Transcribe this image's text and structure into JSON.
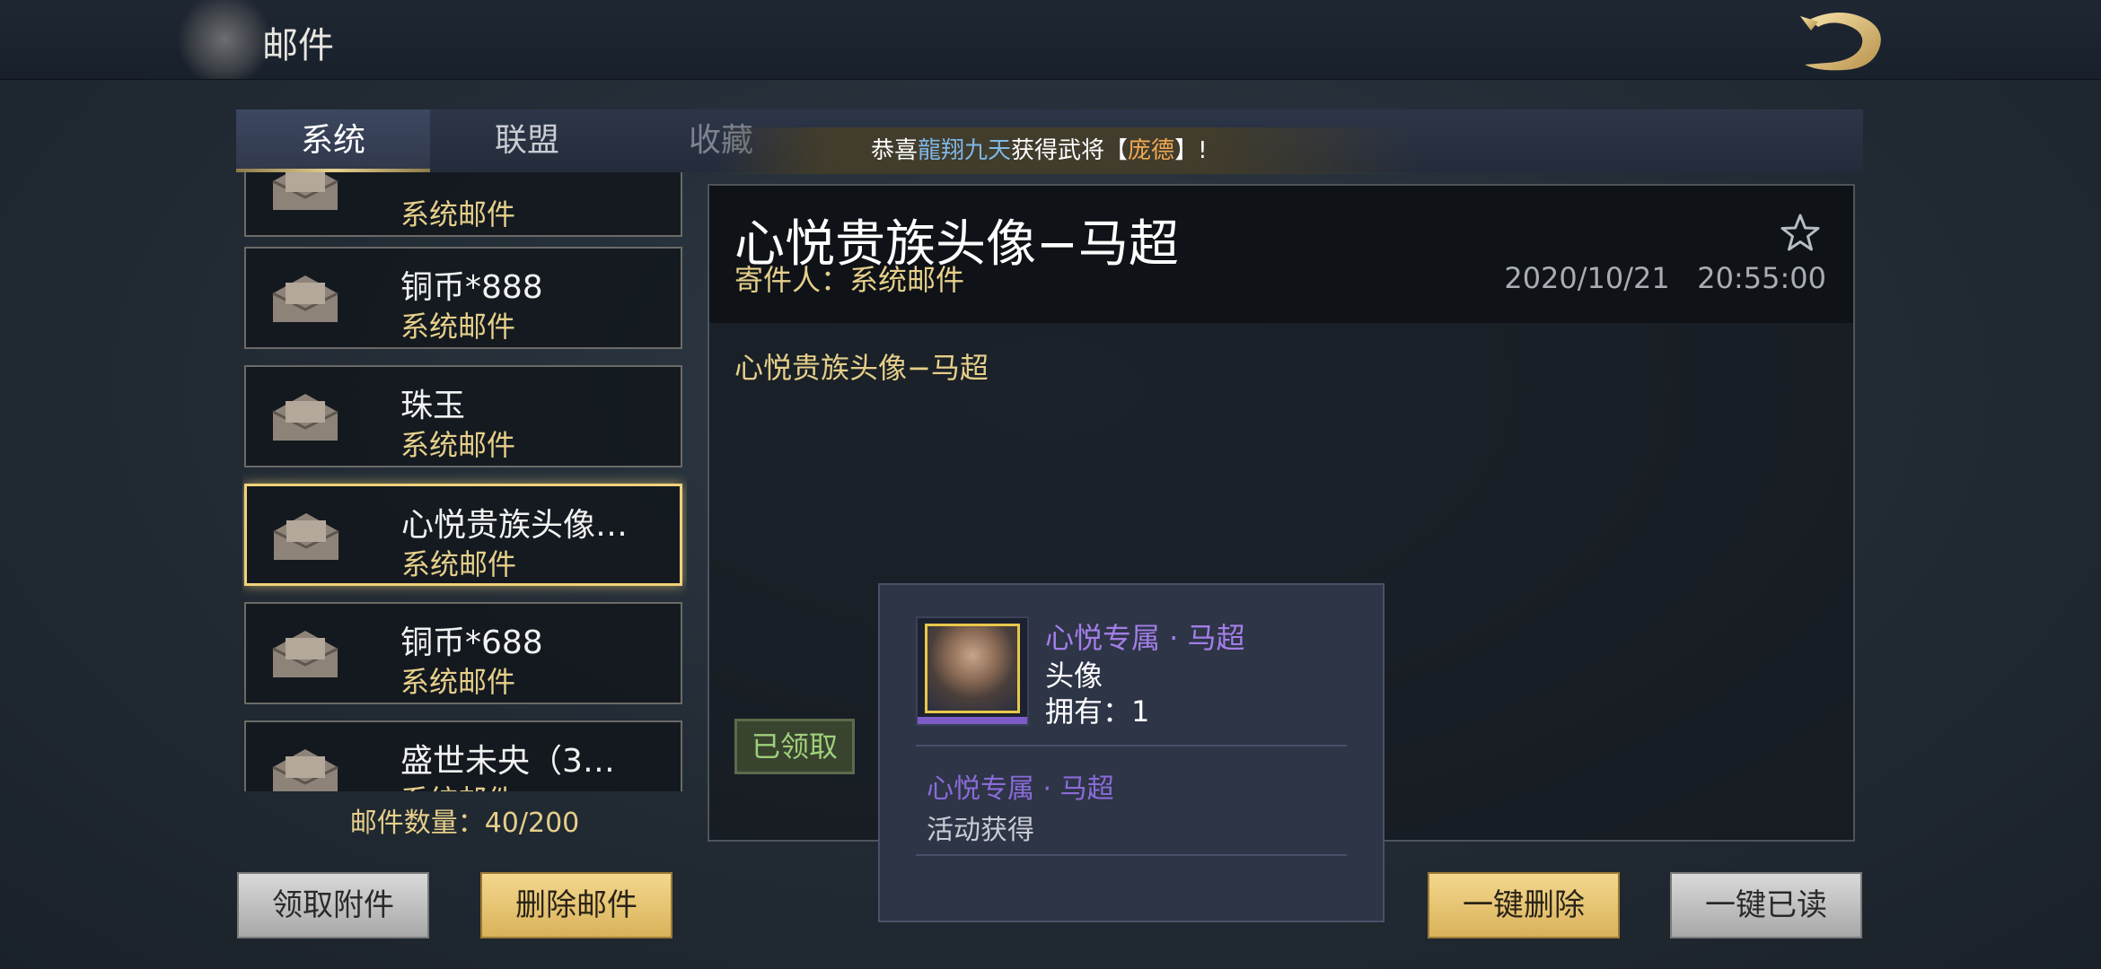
{
  "header": {
    "title": "邮件"
  },
  "tabs": [
    {
      "label": "系统"
    },
    {
      "label": "联盟"
    },
    {
      "label": "收藏"
    }
  ],
  "marquee": {
    "prefix": "恭喜",
    "player": "龍翔九天",
    "middle": "获得武将【",
    "general": "庞德",
    "suffix": "】!"
  },
  "mail_list": {
    "items": [
      {
        "title": "",
        "sender": "系统邮件"
      },
      {
        "title": "铜币*888",
        "sender": "系统邮件"
      },
      {
        "title": "珠玉",
        "sender": "系统邮件"
      },
      {
        "title": "心悦贵族头像…",
        "sender": "系统邮件"
      },
      {
        "title": "铜币*688",
        "sender": "系统邮件"
      },
      {
        "title": "盛世未央（3…",
        "sender": "系统邮件"
      }
    ],
    "count_label": "邮件数量：40/200"
  },
  "detail": {
    "subject": "心悦贵族头像−马超",
    "sender": "寄件人：系统邮件",
    "date": "2020/10/21",
    "time": "20:55:00",
    "body": "心悦贵族头像−马超",
    "claimed_label": "已领取"
  },
  "item_popup": {
    "name": "心悦专属 · 马超",
    "type": "头像",
    "owned": "拥有：1",
    "name2": "心悦专属 · 马超",
    "source": "活动获得"
  },
  "buttons": {
    "claim_attachments": "领取附件",
    "delete_mail": "删除邮件",
    "delete_all": "一键删除",
    "read_all": "一键已读"
  },
  "colors": {
    "gold": "#e6cf8a",
    "purple": "#a37ee8",
    "highlight": "#f1d27a"
  }
}
